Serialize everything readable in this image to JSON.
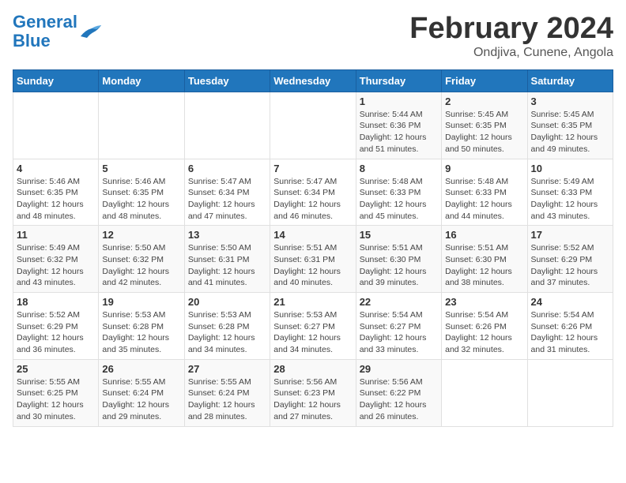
{
  "header": {
    "logo_line1": "General",
    "logo_line2": "Blue",
    "main_title": "February 2024",
    "subtitle": "Ondjiva, Cunene, Angola"
  },
  "columns": [
    "Sunday",
    "Monday",
    "Tuesday",
    "Wednesday",
    "Thursday",
    "Friday",
    "Saturday"
  ],
  "weeks": [
    [
      {
        "day": "",
        "info": ""
      },
      {
        "day": "",
        "info": ""
      },
      {
        "day": "",
        "info": ""
      },
      {
        "day": "",
        "info": ""
      },
      {
        "day": "1",
        "info": "Sunrise: 5:44 AM\nSunset: 6:36 PM\nDaylight: 12 hours and 51 minutes."
      },
      {
        "day": "2",
        "info": "Sunrise: 5:45 AM\nSunset: 6:35 PM\nDaylight: 12 hours and 50 minutes."
      },
      {
        "day": "3",
        "info": "Sunrise: 5:45 AM\nSunset: 6:35 PM\nDaylight: 12 hours and 49 minutes."
      }
    ],
    [
      {
        "day": "4",
        "info": "Sunrise: 5:46 AM\nSunset: 6:35 PM\nDaylight: 12 hours and 48 minutes."
      },
      {
        "day": "5",
        "info": "Sunrise: 5:46 AM\nSunset: 6:35 PM\nDaylight: 12 hours and 48 minutes."
      },
      {
        "day": "6",
        "info": "Sunrise: 5:47 AM\nSunset: 6:34 PM\nDaylight: 12 hours and 47 minutes."
      },
      {
        "day": "7",
        "info": "Sunrise: 5:47 AM\nSunset: 6:34 PM\nDaylight: 12 hours and 46 minutes."
      },
      {
        "day": "8",
        "info": "Sunrise: 5:48 AM\nSunset: 6:33 PM\nDaylight: 12 hours and 45 minutes."
      },
      {
        "day": "9",
        "info": "Sunrise: 5:48 AM\nSunset: 6:33 PM\nDaylight: 12 hours and 44 minutes."
      },
      {
        "day": "10",
        "info": "Sunrise: 5:49 AM\nSunset: 6:33 PM\nDaylight: 12 hours and 43 minutes."
      }
    ],
    [
      {
        "day": "11",
        "info": "Sunrise: 5:49 AM\nSunset: 6:32 PM\nDaylight: 12 hours and 43 minutes."
      },
      {
        "day": "12",
        "info": "Sunrise: 5:50 AM\nSunset: 6:32 PM\nDaylight: 12 hours and 42 minutes."
      },
      {
        "day": "13",
        "info": "Sunrise: 5:50 AM\nSunset: 6:31 PM\nDaylight: 12 hours and 41 minutes."
      },
      {
        "day": "14",
        "info": "Sunrise: 5:51 AM\nSunset: 6:31 PM\nDaylight: 12 hours and 40 minutes."
      },
      {
        "day": "15",
        "info": "Sunrise: 5:51 AM\nSunset: 6:30 PM\nDaylight: 12 hours and 39 minutes."
      },
      {
        "day": "16",
        "info": "Sunrise: 5:51 AM\nSunset: 6:30 PM\nDaylight: 12 hours and 38 minutes."
      },
      {
        "day": "17",
        "info": "Sunrise: 5:52 AM\nSunset: 6:29 PM\nDaylight: 12 hours and 37 minutes."
      }
    ],
    [
      {
        "day": "18",
        "info": "Sunrise: 5:52 AM\nSunset: 6:29 PM\nDaylight: 12 hours and 36 minutes."
      },
      {
        "day": "19",
        "info": "Sunrise: 5:53 AM\nSunset: 6:28 PM\nDaylight: 12 hours and 35 minutes."
      },
      {
        "day": "20",
        "info": "Sunrise: 5:53 AM\nSunset: 6:28 PM\nDaylight: 12 hours and 34 minutes."
      },
      {
        "day": "21",
        "info": "Sunrise: 5:53 AM\nSunset: 6:27 PM\nDaylight: 12 hours and 34 minutes."
      },
      {
        "day": "22",
        "info": "Sunrise: 5:54 AM\nSunset: 6:27 PM\nDaylight: 12 hours and 33 minutes."
      },
      {
        "day": "23",
        "info": "Sunrise: 5:54 AM\nSunset: 6:26 PM\nDaylight: 12 hours and 32 minutes."
      },
      {
        "day": "24",
        "info": "Sunrise: 5:54 AM\nSunset: 6:26 PM\nDaylight: 12 hours and 31 minutes."
      }
    ],
    [
      {
        "day": "25",
        "info": "Sunrise: 5:55 AM\nSunset: 6:25 PM\nDaylight: 12 hours and 30 minutes."
      },
      {
        "day": "26",
        "info": "Sunrise: 5:55 AM\nSunset: 6:24 PM\nDaylight: 12 hours and 29 minutes."
      },
      {
        "day": "27",
        "info": "Sunrise: 5:55 AM\nSunset: 6:24 PM\nDaylight: 12 hours and 28 minutes."
      },
      {
        "day": "28",
        "info": "Sunrise: 5:56 AM\nSunset: 6:23 PM\nDaylight: 12 hours and 27 minutes."
      },
      {
        "day": "29",
        "info": "Sunrise: 5:56 AM\nSunset: 6:22 PM\nDaylight: 12 hours and 26 minutes."
      },
      {
        "day": "",
        "info": ""
      },
      {
        "day": "",
        "info": ""
      }
    ]
  ]
}
